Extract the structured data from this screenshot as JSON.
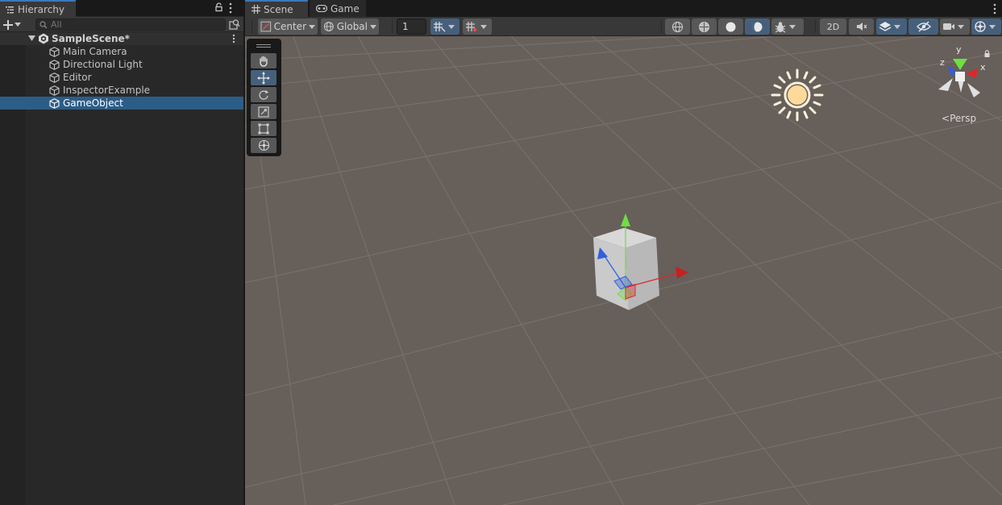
{
  "hierarchy": {
    "tab_title": "Hierarchy",
    "search_placeholder": "All",
    "scene_name": "SampleScene*",
    "objects": [
      {
        "name": "Main Camera",
        "selected": false
      },
      {
        "name": "Directional Light",
        "selected": false
      },
      {
        "name": "Editor",
        "selected": false
      },
      {
        "name": "InspectorExample",
        "selected": false
      },
      {
        "name": "GameObject",
        "selected": true
      }
    ]
  },
  "scene_view": {
    "tabs": [
      {
        "label": "Scene",
        "active": true,
        "icon": "grid-icon"
      },
      {
        "label": "Game",
        "active": false,
        "icon": "gamepad-icon"
      }
    ],
    "toolbar": {
      "pivot_label": "Center",
      "space_label": "Global",
      "snap_value": "1",
      "mode_2d_label": "2D"
    },
    "camera_mode_label": "Persp",
    "gizmo_axes": {
      "y": "y",
      "x": "x",
      "z": "z"
    }
  },
  "colors": {
    "accent": "#3a79bb",
    "selection": "#2c5d87",
    "viewport_bg": "#675f5a",
    "axis_x": "#e0262a",
    "axis_y": "#6ee040",
    "axis_z": "#2f5fe0"
  }
}
